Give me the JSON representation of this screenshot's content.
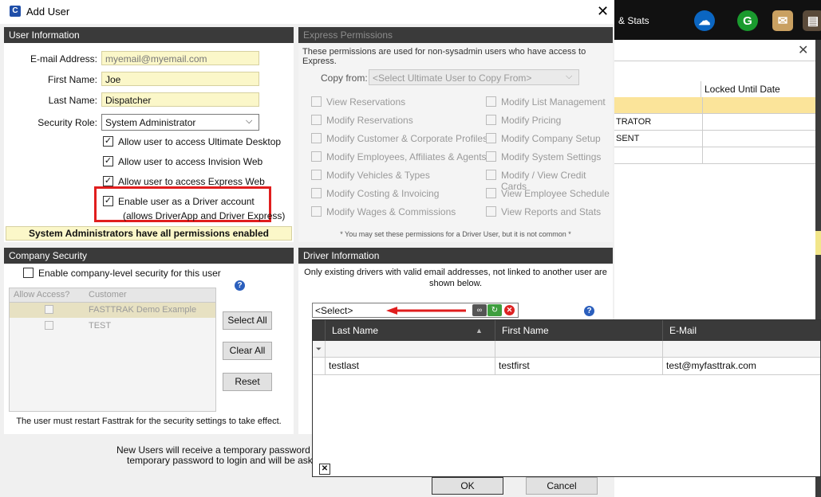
{
  "window": {
    "title": "Add User"
  },
  "background_app": {
    "stats_label": "& Stats",
    "grid_header": "Locked Until Date",
    "rows": [
      "",
      "TRATOR",
      "SENT",
      ""
    ]
  },
  "user_info": {
    "header": "User Information",
    "email_label": "E-mail Address:",
    "email_value": "myemail@myemail.com",
    "first_name_label": "First Name:",
    "first_name_value": "Joe",
    "last_name_label": "Last Name:",
    "last_name_value": "Dispatcher",
    "security_role_label": "Security Role:",
    "security_role_value": "System Administrator",
    "checks": [
      {
        "label": "Allow user to access Ultimate Desktop",
        "checked": true
      },
      {
        "label": "Allow user to access Invision Web",
        "checked": true
      },
      {
        "label": "Allow user to access Express Web",
        "checked": true
      }
    ],
    "driver_check_line1": "Enable user as a Driver account",
    "driver_check_line2": "(allows DriverApp and Driver Express)",
    "admin_notice": "System Administrators have all permissions enabled"
  },
  "express": {
    "header": "Express Permissions",
    "note": "These permissions are used for non-sysadmin users who have access to Express.",
    "copy_from_label": "Copy from:",
    "copy_from_value": "<Select Ultimate User to Copy From>",
    "left_perms": [
      "View Reservations",
      "Modify Reservations",
      "Modify Customer & Corporate Profiles",
      "Modify Employees, Affiliates & Agents",
      "Modify Vehicles & Types",
      "Modify Costing & Invoicing",
      "Modify Wages & Commissions"
    ],
    "right_perms": [
      "Modify List Management",
      "Modify Pricing",
      "Modify Company Setup",
      "Modify System Settings",
      "Modify / View Credit Cards",
      "View Employee Schedule",
      "View Reports and Stats"
    ],
    "footnote": "* You may set these permissions for a Driver User, but it is not common *"
  },
  "company_security": {
    "header": "Company Security",
    "enable_label": "Enable company-level security for this user",
    "col_allow": "Allow Access?",
    "col_customer": "Customer",
    "rows": [
      "FASTTRAK Demo Example",
      "TEST"
    ],
    "select_all": "Select All",
    "clear_all": "Clear All",
    "reset": "Reset",
    "restart_note": "The user must restart Fasttrak for the security settings to take effect."
  },
  "driver_info": {
    "header": "Driver Information",
    "note": "Only existing drivers with valid email addresses, not linked to another user are shown below.",
    "select_value": "<Select>"
  },
  "driver_grid": {
    "columns": [
      "Last Name",
      "First Name",
      "E-Mail"
    ],
    "rows": [
      {
        "last": "testlast",
        "first": "testfirst",
        "email": "test@myfasttrak.com"
      }
    ]
  },
  "footer": {
    "line1": "New Users will receive a temporary password to his/",
    "line2": "temporary password to login and will be asked to",
    "ok": "OK",
    "cancel": "Cancel"
  }
}
